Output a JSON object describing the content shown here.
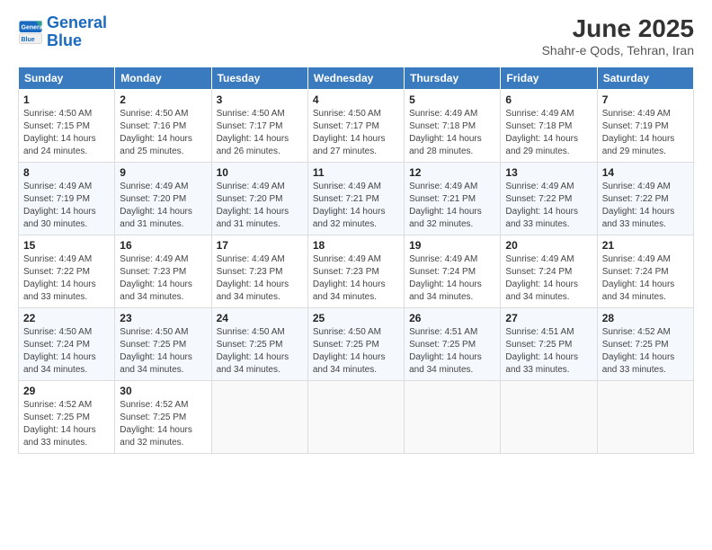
{
  "header": {
    "logo_line1": "General",
    "logo_line2": "Blue",
    "month": "June 2025",
    "location": "Shahr-e Qods, Tehran, Iran"
  },
  "weekdays": [
    "Sunday",
    "Monday",
    "Tuesday",
    "Wednesday",
    "Thursday",
    "Friday",
    "Saturday"
  ],
  "weeks": [
    [
      {
        "day": "1",
        "info": "Sunrise: 4:50 AM\nSunset: 7:15 PM\nDaylight: 14 hours\nand 24 minutes."
      },
      {
        "day": "2",
        "info": "Sunrise: 4:50 AM\nSunset: 7:16 PM\nDaylight: 14 hours\nand 25 minutes."
      },
      {
        "day": "3",
        "info": "Sunrise: 4:50 AM\nSunset: 7:17 PM\nDaylight: 14 hours\nand 26 minutes."
      },
      {
        "day": "4",
        "info": "Sunrise: 4:50 AM\nSunset: 7:17 PM\nDaylight: 14 hours\nand 27 minutes."
      },
      {
        "day": "5",
        "info": "Sunrise: 4:49 AM\nSunset: 7:18 PM\nDaylight: 14 hours\nand 28 minutes."
      },
      {
        "day": "6",
        "info": "Sunrise: 4:49 AM\nSunset: 7:18 PM\nDaylight: 14 hours\nand 29 minutes."
      },
      {
        "day": "7",
        "info": "Sunrise: 4:49 AM\nSunset: 7:19 PM\nDaylight: 14 hours\nand 29 minutes."
      }
    ],
    [
      {
        "day": "8",
        "info": "Sunrise: 4:49 AM\nSunset: 7:19 PM\nDaylight: 14 hours\nand 30 minutes."
      },
      {
        "day": "9",
        "info": "Sunrise: 4:49 AM\nSunset: 7:20 PM\nDaylight: 14 hours\nand 31 minutes."
      },
      {
        "day": "10",
        "info": "Sunrise: 4:49 AM\nSunset: 7:20 PM\nDaylight: 14 hours\nand 31 minutes."
      },
      {
        "day": "11",
        "info": "Sunrise: 4:49 AM\nSunset: 7:21 PM\nDaylight: 14 hours\nand 32 minutes."
      },
      {
        "day": "12",
        "info": "Sunrise: 4:49 AM\nSunset: 7:21 PM\nDaylight: 14 hours\nand 32 minutes."
      },
      {
        "day": "13",
        "info": "Sunrise: 4:49 AM\nSunset: 7:22 PM\nDaylight: 14 hours\nand 33 minutes."
      },
      {
        "day": "14",
        "info": "Sunrise: 4:49 AM\nSunset: 7:22 PM\nDaylight: 14 hours\nand 33 minutes."
      }
    ],
    [
      {
        "day": "15",
        "info": "Sunrise: 4:49 AM\nSunset: 7:22 PM\nDaylight: 14 hours\nand 33 minutes."
      },
      {
        "day": "16",
        "info": "Sunrise: 4:49 AM\nSunset: 7:23 PM\nDaylight: 14 hours\nand 34 minutes."
      },
      {
        "day": "17",
        "info": "Sunrise: 4:49 AM\nSunset: 7:23 PM\nDaylight: 14 hours\nand 34 minutes."
      },
      {
        "day": "18",
        "info": "Sunrise: 4:49 AM\nSunset: 7:23 PM\nDaylight: 14 hours\nand 34 minutes."
      },
      {
        "day": "19",
        "info": "Sunrise: 4:49 AM\nSunset: 7:24 PM\nDaylight: 14 hours\nand 34 minutes."
      },
      {
        "day": "20",
        "info": "Sunrise: 4:49 AM\nSunset: 7:24 PM\nDaylight: 14 hours\nand 34 minutes."
      },
      {
        "day": "21",
        "info": "Sunrise: 4:49 AM\nSunset: 7:24 PM\nDaylight: 14 hours\nand 34 minutes."
      }
    ],
    [
      {
        "day": "22",
        "info": "Sunrise: 4:50 AM\nSunset: 7:24 PM\nDaylight: 14 hours\nand 34 minutes."
      },
      {
        "day": "23",
        "info": "Sunrise: 4:50 AM\nSunset: 7:25 PM\nDaylight: 14 hours\nand 34 minutes."
      },
      {
        "day": "24",
        "info": "Sunrise: 4:50 AM\nSunset: 7:25 PM\nDaylight: 14 hours\nand 34 minutes."
      },
      {
        "day": "25",
        "info": "Sunrise: 4:50 AM\nSunset: 7:25 PM\nDaylight: 14 hours\nand 34 minutes."
      },
      {
        "day": "26",
        "info": "Sunrise: 4:51 AM\nSunset: 7:25 PM\nDaylight: 14 hours\nand 34 minutes."
      },
      {
        "day": "27",
        "info": "Sunrise: 4:51 AM\nSunset: 7:25 PM\nDaylight: 14 hours\nand 33 minutes."
      },
      {
        "day": "28",
        "info": "Sunrise: 4:52 AM\nSunset: 7:25 PM\nDaylight: 14 hours\nand 33 minutes."
      }
    ],
    [
      {
        "day": "29",
        "info": "Sunrise: 4:52 AM\nSunset: 7:25 PM\nDaylight: 14 hours\nand 33 minutes."
      },
      {
        "day": "30",
        "info": "Sunrise: 4:52 AM\nSunset: 7:25 PM\nDaylight: 14 hours\nand 32 minutes."
      },
      {
        "day": "",
        "info": ""
      },
      {
        "day": "",
        "info": ""
      },
      {
        "day": "",
        "info": ""
      },
      {
        "day": "",
        "info": ""
      },
      {
        "day": "",
        "info": ""
      }
    ]
  ]
}
